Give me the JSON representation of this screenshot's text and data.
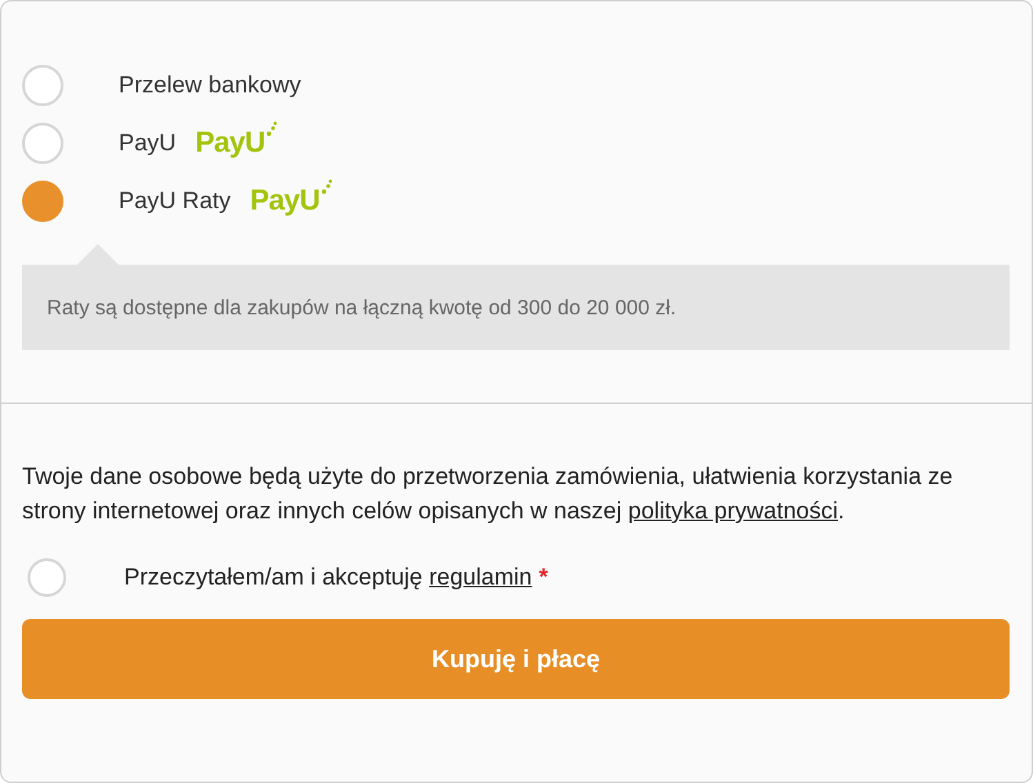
{
  "payment_methods": [
    {
      "label": "Przelew bankowy",
      "selected": false
    },
    {
      "label": "PayU",
      "logo": "PayU",
      "selected": false
    },
    {
      "label": "PayU Raty",
      "logo": "PayU",
      "selected": true
    }
  ],
  "info_note": "Raty są dostępne dla zakupów na łączną kwotę od 300 do 20 000 zł.",
  "privacy_notice": {
    "text": "Twoje dane osobowe będą użyte do przetworzenia zamówienia, ułatwienia korzystania ze strony internetowej oraz innych celów opisanych w naszej ",
    "link": "polityka prywatności",
    "end": "."
  },
  "terms": {
    "text": "Przeczytałem/am i akceptuję ",
    "link": "regulamin",
    "required_mark": "*",
    "checked": false
  },
  "submit_button": "Kupuję i płacę"
}
